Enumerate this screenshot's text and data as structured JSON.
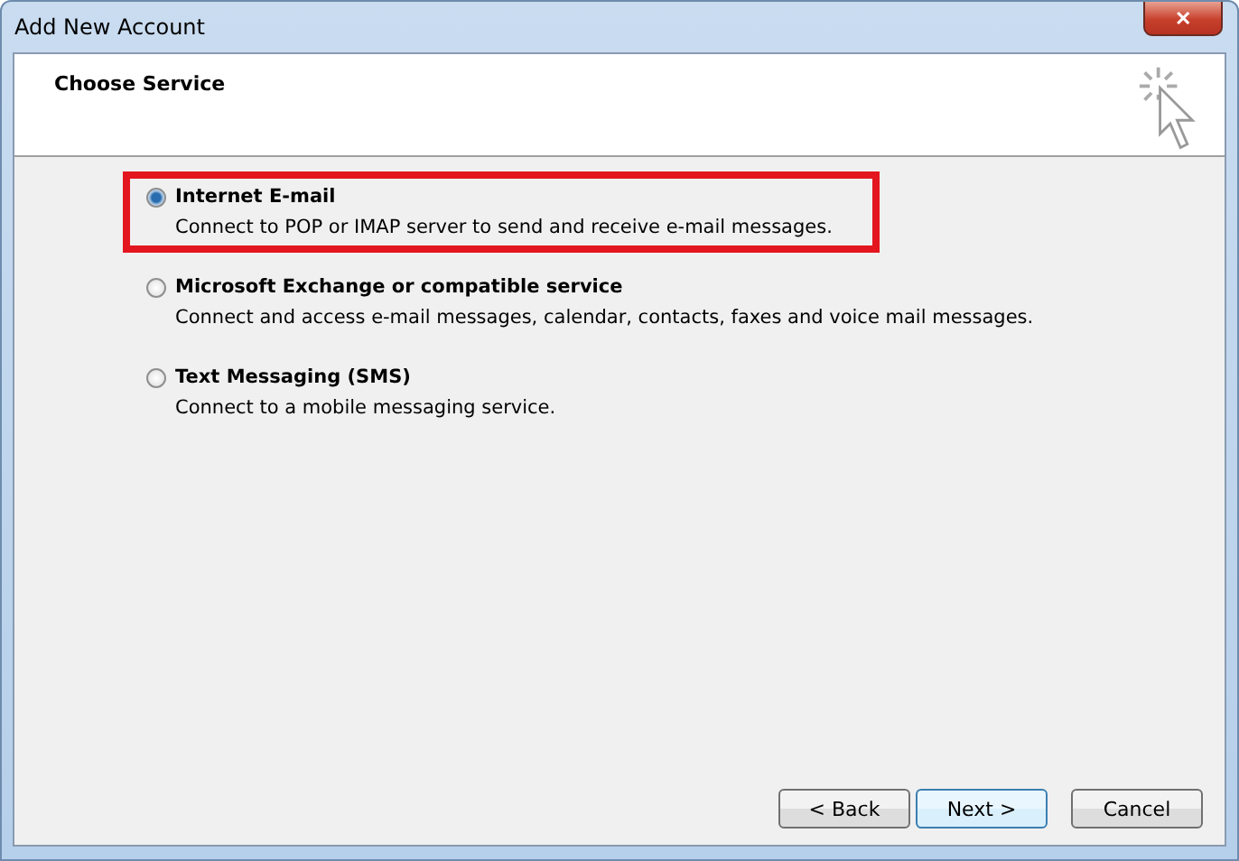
{
  "window": {
    "title": "Add New Account",
    "close": "✕"
  },
  "header": {
    "title": "Choose Service"
  },
  "options": [
    {
      "label": "Internet E-mail",
      "description": "Connect to POP or IMAP server to send and receive e-mail messages.",
      "selected": true,
      "highlighted": true
    },
    {
      "label": "Microsoft Exchange or compatible service",
      "description": "Connect and access e-mail messages, calendar, contacts, faxes and voice mail messages.",
      "selected": false,
      "highlighted": false
    },
    {
      "label": "Text Messaging (SMS)",
      "description": "Connect to a mobile messaging service.",
      "selected": false,
      "highlighted": false
    }
  ],
  "buttons": [
    {
      "label": "< Back",
      "default": false
    },
    {
      "label": "Next >",
      "default": true
    },
    {
      "label": "Cancel",
      "default": false
    }
  ]
}
